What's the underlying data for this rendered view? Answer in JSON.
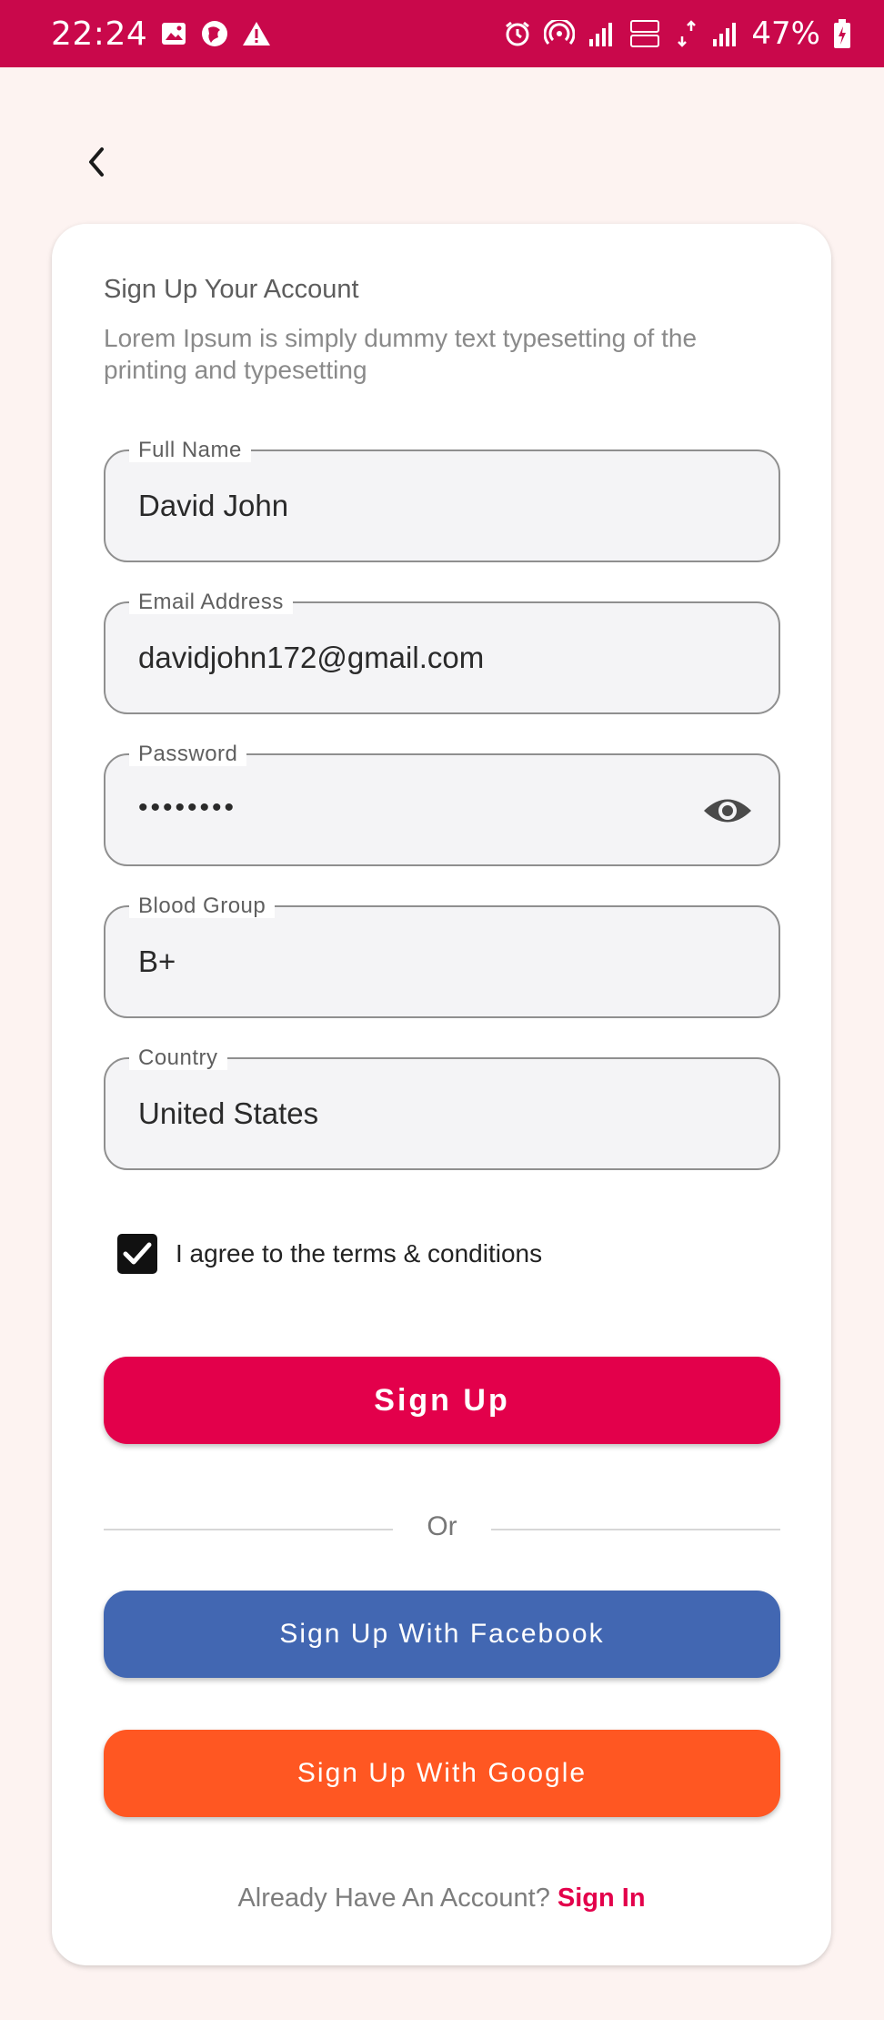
{
  "status_bar": {
    "time": "22:24",
    "battery": "47%",
    "icons_left": [
      "image-icon",
      "vpn-icon",
      "warning-icon"
    ],
    "icons_right": [
      "alarm-icon",
      "hotspot-icon",
      "signal-icon",
      "volte-icon",
      "4g-icon",
      "signal-icon",
      "battery-icon"
    ],
    "background_color": "#c9084b"
  },
  "header": {
    "back_icon": "chevron-left-icon"
  },
  "form": {
    "title": "Sign Up Your Account",
    "subtitle": "Lorem Ipsum is simply dummy text typesetting of the printing and typesetting",
    "fields": [
      {
        "label": "Full Name",
        "value": "David John"
      },
      {
        "label": "Email Address",
        "value": "davidjohn172@gmail.com"
      },
      {
        "label": "Password",
        "value": "••••••••",
        "toggle_icon": "eye-icon"
      },
      {
        "label": "Blood Group",
        "value": "B+"
      },
      {
        "label": "Country",
        "value": "United States"
      }
    ],
    "terms": {
      "checked": true,
      "label": "I agree to the terms & conditions"
    },
    "signup_button": "Sign Up",
    "divider_text": "Or",
    "facebook_button": "Sign Up With Facebook",
    "google_button": "Sign Up With Google",
    "footer": {
      "prompt": "Already Have An Account?",
      "link": "Sign In"
    }
  },
  "colors": {
    "accent": "#e3004b",
    "facebook": "#4267b2",
    "google": "#ff5722",
    "background": "#fdf3f1"
  }
}
